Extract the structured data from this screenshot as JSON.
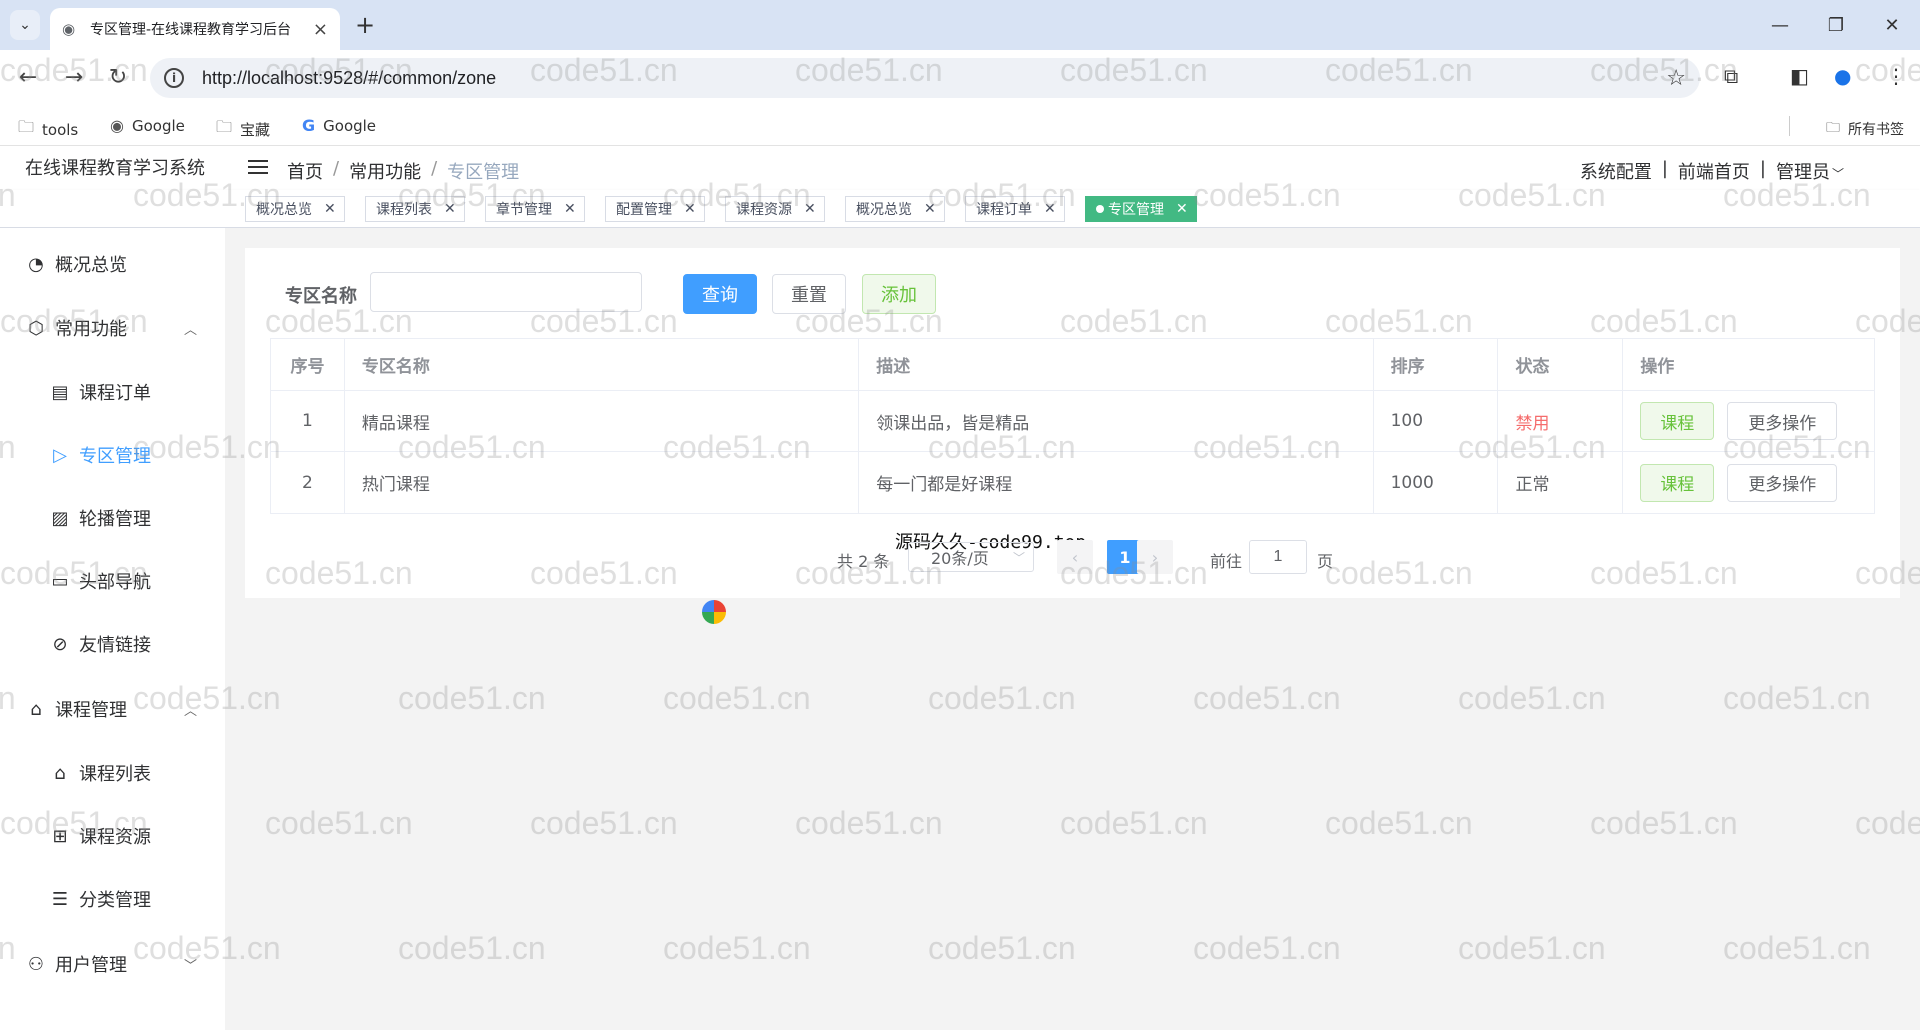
{
  "browser": {
    "tab_title": "专区管理-在线课程教育学习后台",
    "url": "http://localhost:9528/#/common/zone",
    "bookmarks": [
      "tools",
      "Google",
      "宝藏",
      "Google"
    ],
    "all_bookmarks": "所有书签"
  },
  "header": {
    "app_title": "在线课程教育学习系统",
    "breadcrumb": [
      "首页",
      "常用功能",
      "专区管理"
    ],
    "right_links": [
      "系统配置",
      "前端首页",
      "管理员"
    ]
  },
  "tags": [
    {
      "label": "概况总览",
      "active": false
    },
    {
      "label": "课程列表",
      "active": false
    },
    {
      "label": "章节管理",
      "active": false
    },
    {
      "label": "配置管理",
      "active": false
    },
    {
      "label": "课程资源",
      "active": false
    },
    {
      "label": "概况总览",
      "active": false
    },
    {
      "label": "课程订单",
      "active": false
    },
    {
      "label": "专区管理",
      "active": true
    }
  ],
  "sidebar": {
    "items": [
      {
        "label": "概况总览",
        "icon": "dashboard-icon"
      },
      {
        "label": "常用功能",
        "icon": "cube-icon"
      },
      {
        "label": "课程订单",
        "icon": "document-icon"
      },
      {
        "label": "专区管理",
        "icon": "video-icon"
      },
      {
        "label": "轮播管理",
        "icon": "image-icon"
      },
      {
        "label": "头部导航",
        "icon": "window-icon"
      },
      {
        "label": "友情链接",
        "icon": "link-icon"
      },
      {
        "label": "课程管理",
        "icon": "graduation-cap-icon"
      },
      {
        "label": "课程列表",
        "icon": "graduation-cap-icon"
      },
      {
        "label": "课程资源",
        "icon": "grid-icon"
      },
      {
        "label": "分类管理",
        "icon": "list-icon"
      },
      {
        "label": "用户管理",
        "icon": "users-icon"
      }
    ]
  },
  "search": {
    "label": "专区名称",
    "value": "",
    "query_label": "查询",
    "reset_label": "重置",
    "add_label": "添加"
  },
  "table": {
    "headers": [
      "序号",
      "专区名称",
      "描述",
      "排序",
      "状态",
      "操作"
    ],
    "rows": [
      {
        "index": "1",
        "name": "精品课程",
        "desc": "领课出品，皆是精品",
        "sort": "100",
        "status": "禁用"
      },
      {
        "index": "2",
        "name": "热门课程",
        "desc": "每一门都是好课程",
        "sort": "1000",
        "status": "正常"
      }
    ],
    "op_course_label": "课程",
    "op_more_label": "更多操作"
  },
  "source_text": "源码久久-code99.top",
  "pagination": {
    "total": "共 2 条",
    "page_size": "20条/页",
    "current_page": "1",
    "goto_label": "前往",
    "goto_value": "1",
    "page_label": "页"
  },
  "watermark": "code51.cn",
  "colors": {
    "primary": "#409eff",
    "success": "#67c23a",
    "danger": "#f56c6c",
    "tag_active": "#42b983"
  }
}
